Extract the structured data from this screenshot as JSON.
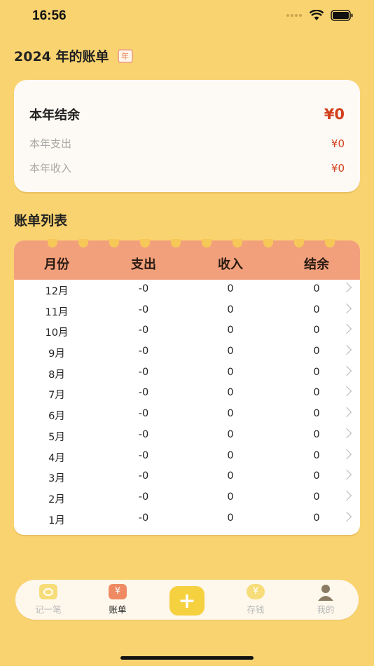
{
  "status_bar": {
    "time": "16:56"
  },
  "header": {
    "title": "2024 年的账单",
    "badge_label": "年"
  },
  "summary": {
    "balance_label": "本年结余",
    "balance_value": "¥0",
    "expense_label": "本年支出",
    "expense_value": "¥0",
    "income_label": "本年收入",
    "income_value": "¥0"
  },
  "list": {
    "title": "账单列表",
    "headers": [
      "月份",
      "支出",
      "收入",
      "结余"
    ],
    "rows": [
      {
        "month": "12月",
        "expense": "-0",
        "income": "0",
        "balance": "0"
      },
      {
        "month": "11月",
        "expense": "-0",
        "income": "0",
        "balance": "0"
      },
      {
        "month": "10月",
        "expense": "-0",
        "income": "0",
        "balance": "0"
      },
      {
        "month": "9月",
        "expense": "-0",
        "income": "0",
        "balance": "0"
      },
      {
        "month": "8月",
        "expense": "-0",
        "income": "0",
        "balance": "0"
      },
      {
        "month": "7月",
        "expense": "-0",
        "income": "0",
        "balance": "0"
      },
      {
        "month": "6月",
        "expense": "-0",
        "income": "0",
        "balance": "0"
      },
      {
        "month": "5月",
        "expense": "-0",
        "income": "0",
        "balance": "0"
      },
      {
        "month": "4月",
        "expense": "-0",
        "income": "0",
        "balance": "0"
      },
      {
        "month": "3月",
        "expense": "-0",
        "income": "0",
        "balance": "0"
      },
      {
        "month": "2月",
        "expense": "-0",
        "income": "0",
        "balance": "0"
      },
      {
        "month": "1月",
        "expense": "-0",
        "income": "0",
        "balance": "0"
      }
    ]
  },
  "tabbar": {
    "tabs": [
      {
        "label": "记一笔",
        "icon": "note-icon"
      },
      {
        "label": "账单",
        "icon": "bill-icon",
        "active": true
      },
      {
        "label": "+",
        "icon": "plus-icon"
      },
      {
        "label": "存钱",
        "icon": "savings-icon"
      },
      {
        "label": "我的",
        "icon": "profile-icon"
      }
    ],
    "bill_icon_glyph": "¥",
    "savings_icon_glyph": "¥"
  },
  "colors": {
    "background": "#f9d36f",
    "accent_red": "#d13f1c",
    "table_header": "#f2a07b",
    "plus_button": "#f6d13f"
  }
}
